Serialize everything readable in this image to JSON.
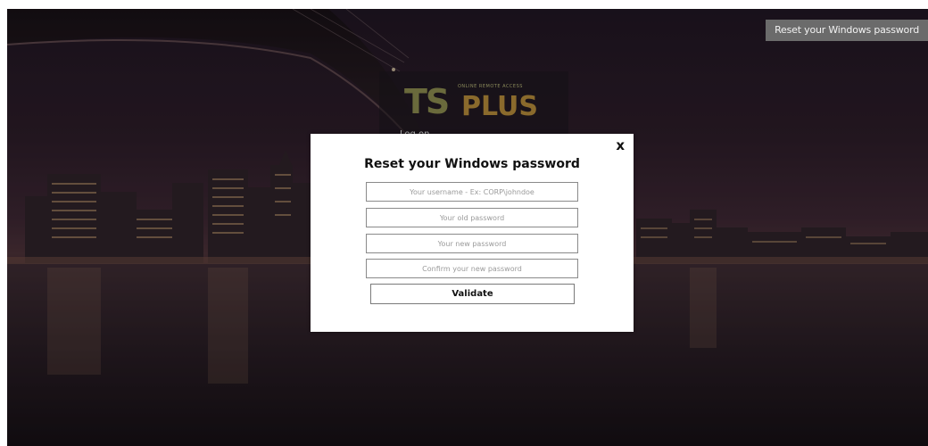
{
  "header": {
    "reset_button_label": "Reset your Windows password"
  },
  "logo": {
    "t": "T",
    "s": "S",
    "plus": "PLUS",
    "tagline": "ONLINE REMOTE ACCESS"
  },
  "login": {
    "logon_label": "Log on"
  },
  "modal": {
    "title": "Reset your Windows password",
    "close_label": "x",
    "username_placeholder": "Your username - Ex: CORP\\johndoe",
    "old_password_placeholder": "Your old password",
    "new_password_placeholder": "Your new password",
    "confirm_password_placeholder": "Confirm your new password",
    "validate_label": "Validate"
  },
  "colors": {
    "modal_background": "#ffffff",
    "top_button_background": "#6b6b6b",
    "logo_accent": "#8a6a2c"
  }
}
